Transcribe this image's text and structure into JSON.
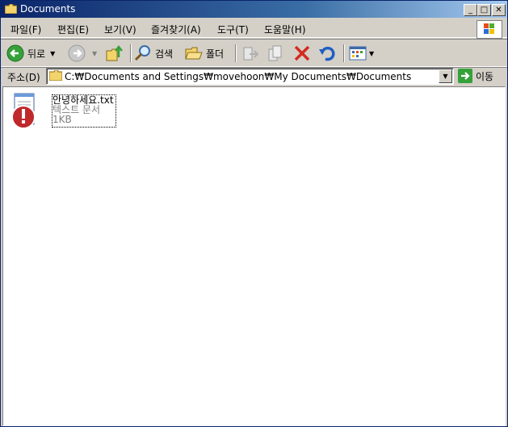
{
  "window": {
    "title": "Documents"
  },
  "menu": [
    "파일(F)",
    "편집(E)",
    "보기(V)",
    "즐겨찾기(A)",
    "도구(T)",
    "도움말(H)"
  ],
  "toolbar": {
    "back": "뒤로",
    "search": "검색",
    "folders": "폴더"
  },
  "address": {
    "label": "주소(D)",
    "value": "C:₩Documents and Settings₩movehoon₩My Documents₩Documents",
    "go": "이동"
  },
  "files": [
    {
      "name": "안녕하세요.txt",
      "type": "텍스트 문서",
      "size": "1KB"
    }
  ],
  "colors": {
    "titlebar": "#0a246a",
    "face": "#d4d0c8",
    "error": "#c0282c"
  }
}
